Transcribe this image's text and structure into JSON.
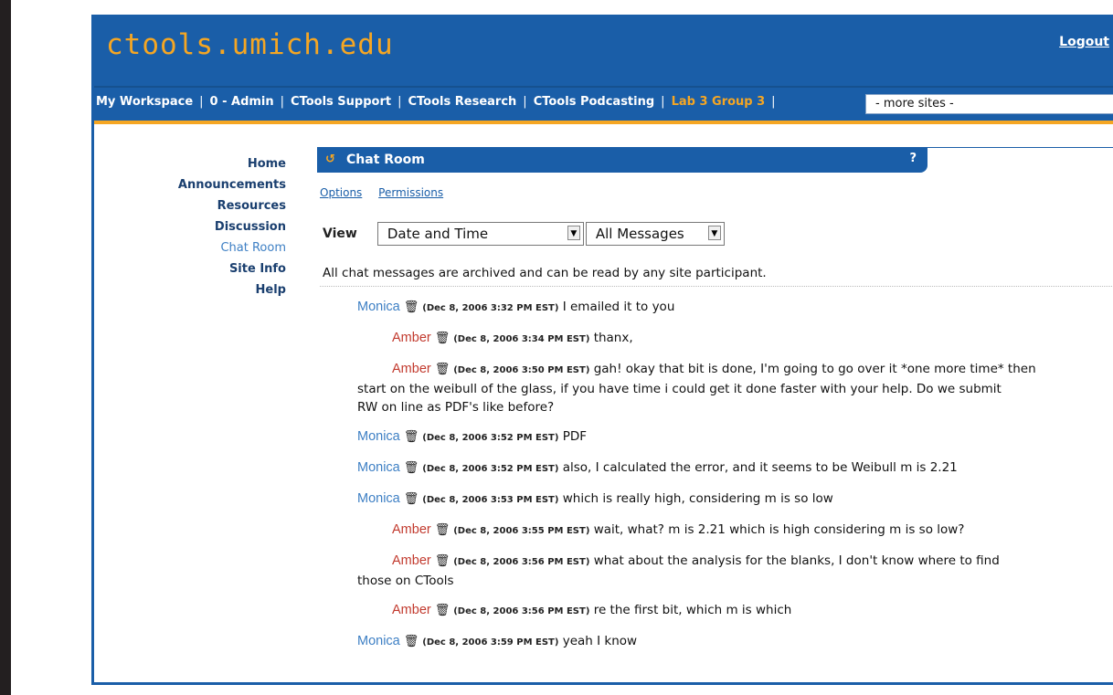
{
  "site_title": "ctools.umich.edu",
  "logout_label": "Logout",
  "tabs": [
    {
      "label": "My Workspace"
    },
    {
      "label": "0 - Admin"
    },
    {
      "label": "CTools Support"
    },
    {
      "label": "CTools Research"
    },
    {
      "label": "CTools Podcasting"
    },
    {
      "label": "Lab 3 Group 3"
    }
  ],
  "more_sites_label": "- more sites -",
  "nav": [
    {
      "label": "Home"
    },
    {
      "label": "Announcements"
    },
    {
      "label": "Resources"
    },
    {
      "label": "Discussion"
    },
    {
      "label": "Chat Room"
    },
    {
      "label": "Site Info"
    },
    {
      "label": "Help"
    }
  ],
  "portlet": {
    "title": "Chat Room",
    "help": "?"
  },
  "toolbar": {
    "options": "Options",
    "permissions": "Permissions"
  },
  "view": {
    "label": "View",
    "sort_value": "Date and Time",
    "filter_value": "All Messages"
  },
  "archive_note": "All chat messages are archived and can be read by any site participant.",
  "messages": [
    {
      "author": "Monica",
      "time": "(Dec 8, 2006 3:32 PM EST)",
      "text": "I emailed it to you"
    },
    {
      "author": "Amber",
      "time": "(Dec 8, 2006 3:34 PM EST)",
      "text": "thanx,"
    },
    {
      "author": "Amber",
      "time": "(Dec 8, 2006 3:50 PM EST)",
      "text": "gah! okay that bit is done, I'm going to go over it *one more time* then",
      "text2": "start on the weibull of the glass, if you have time i could get it done faster with your help. Do we submit",
      "text3": "RW on line as PDF's like before?"
    },
    {
      "author": "Monica",
      "time": "(Dec 8, 2006 3:52 PM EST)",
      "text": "PDF"
    },
    {
      "author": "Monica",
      "time": "(Dec 8, 2006 3:52 PM EST)",
      "text": "also, I calculated the error, and it seems to be Weibull m is 2.21"
    },
    {
      "author": "Monica",
      "time": "(Dec 8, 2006 3:53 PM EST)",
      "text": "which is really high, considering m is so low"
    },
    {
      "author": "Amber",
      "time": "(Dec 8, 2006 3:55 PM EST)",
      "text": "wait, what? m is 2.21 which is high considering m is so low?"
    },
    {
      "author": "Amber",
      "time": "(Dec 8, 2006 3:56 PM EST)",
      "text": "what about the analysis for the blanks, I don't know where to find",
      "text2": "those on CTools"
    },
    {
      "author": "Amber",
      "time": "(Dec 8, 2006 3:56 PM EST)",
      "text": "re the first bit, which m is which"
    },
    {
      "author": "Monica",
      "time": "(Dec 8, 2006 3:59 PM EST)",
      "text": "yeah I know"
    }
  ]
}
